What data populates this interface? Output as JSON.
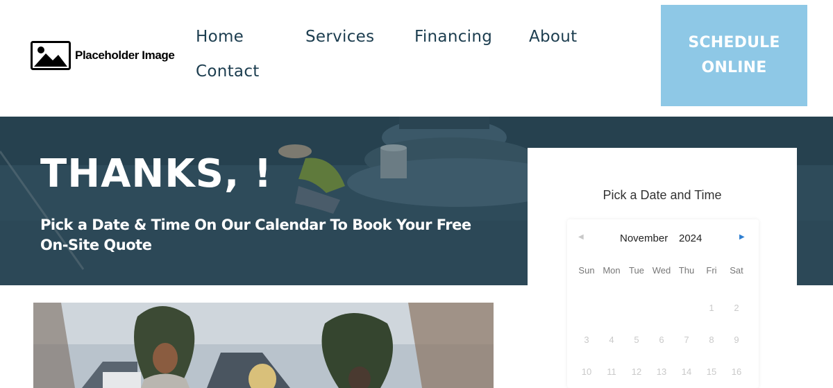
{
  "header": {
    "logo_text": "Placeholder Image",
    "nav": [
      "Home",
      "Services",
      "Financing",
      "About",
      "Contact"
    ],
    "cta_line1": "SCHEDULE",
    "cta_line2": "ONLINE"
  },
  "hero": {
    "title": "THANKS, !",
    "subtitle": "Pick a Date & Time On Our Calendar To Book Your Free On-Site Quote"
  },
  "calendar": {
    "heading": "Pick a Date and Time",
    "month": "November",
    "year": "2024",
    "weekdays": [
      "Sun",
      "Mon",
      "Tue",
      "Wed",
      "Thu",
      "Fri",
      "Sat"
    ],
    "week1": [
      "1",
      "2"
    ],
    "week2": [
      "3",
      "4",
      "5",
      "6",
      "7",
      "8",
      "9"
    ],
    "week3": [
      "10",
      "11",
      "12",
      "13",
      "14",
      "15",
      "16"
    ]
  },
  "colors": {
    "nav_text": "#1c3d4f",
    "cta_bg": "#8ec8e6",
    "hero_overlay": "#2d4a58",
    "next_arrow": "#2f7fd1"
  },
  "icons": {
    "logo": "image-placeholder-icon",
    "prev": "chevron-left-icon",
    "next": "chevron-right-icon"
  }
}
